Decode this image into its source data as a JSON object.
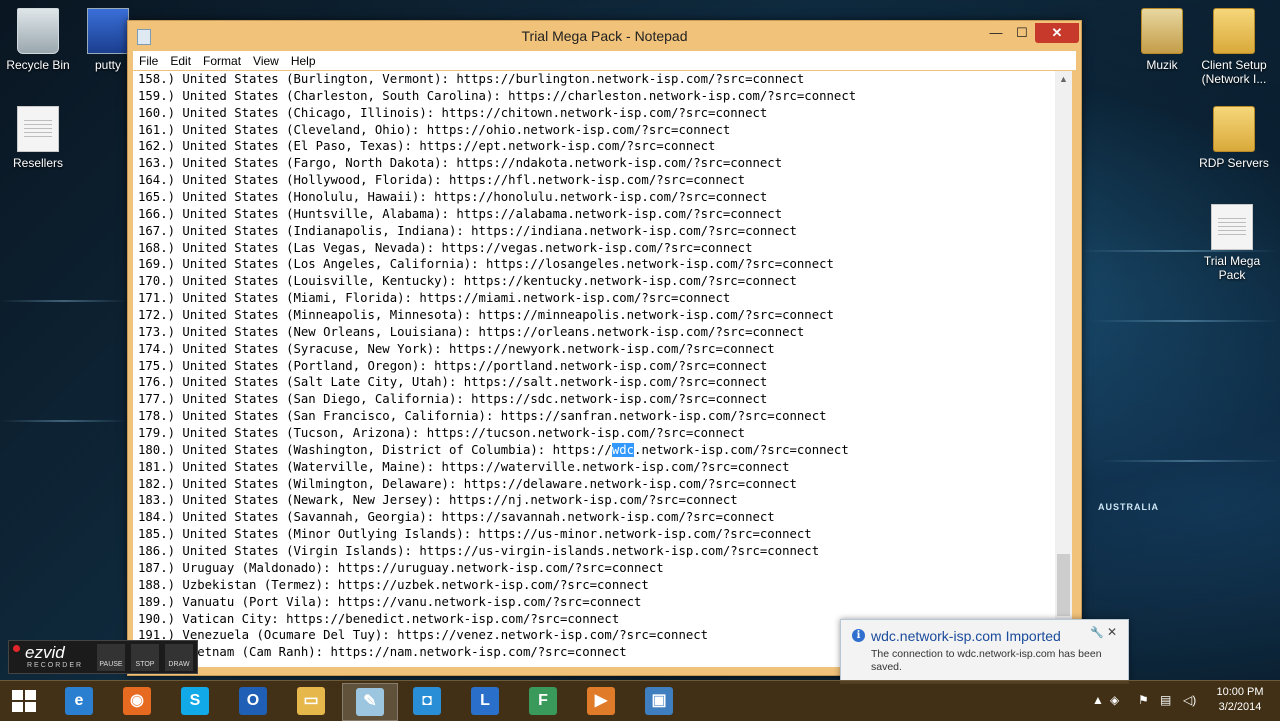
{
  "desktop": {
    "left_icons": [
      {
        "label": "Recycle Bin",
        "icon": "recycle-bin-icon"
      },
      {
        "label": "putty",
        "icon": "putty-icon"
      },
      {
        "label": "Resellers",
        "icon": "text-file-icon"
      }
    ],
    "right_icons": [
      {
        "label": "Muzik",
        "icon": "folder-icon"
      },
      {
        "label": "Client Setup (Network I...",
        "icon": "folder-icon"
      },
      {
        "label": "RDP Servers",
        "icon": "folder-icon"
      },
      {
        "label": "Trial Mega Pack",
        "icon": "text-file-icon"
      }
    ],
    "map_label": "AUSTRALIA"
  },
  "window": {
    "title": "Trial Mega Pack - Notepad",
    "controls": {
      "minimize": "—",
      "maximize": "☐",
      "close": "✕"
    },
    "menu": [
      "File",
      "Edit",
      "Format",
      "View",
      "Help"
    ]
  },
  "editor": {
    "lines": [
      "158.) United States (Burlington, Vermont): https://burlington.network-isp.com/?src=connect",
      "159.) United States (Charleston, South Carolina): https://charleston.network-isp.com/?src=connect",
      "160.) United States (Chicago, Illinois): https://chitown.network-isp.com/?src=connect",
      "161.) United States (Cleveland, Ohio): https://ohio.network-isp.com/?src=connect",
      "162.) United States (El Paso, Texas): https://ept.network-isp.com/?src=connect",
      "163.) United States (Fargo, North Dakota): https://ndakota.network-isp.com/?src=connect",
      "164.) United States (Hollywood, Florida): https://hfl.network-isp.com/?src=connect",
      "165.) United States (Honolulu, Hawaii): https://honolulu.network-isp.com/?src=connect",
      "166.) United States (Huntsville, Alabama): https://alabama.network-isp.com/?src=connect",
      "167.) United States (Indianapolis, Indiana): https://indiana.network-isp.com/?src=connect",
      "168.) United States (Las Vegas, Nevada): https://vegas.network-isp.com/?src=connect",
      "169.) United States (Los Angeles, California): https://losangeles.network-isp.com/?src=connect",
      "170.) United States (Louisville, Kentucky): https://kentucky.network-isp.com/?src=connect",
      "171.) United States (Miami, Florida): https://miami.network-isp.com/?src=connect",
      "172.) United States (Minneapolis, Minnesota): https://minneapolis.network-isp.com/?src=connect",
      "173.) United States (New Orleans, Louisiana): https://orleans.network-isp.com/?src=connect",
      "174.) United States (Syracuse, New York): https://newyork.network-isp.com/?src=connect",
      "175.) United States (Portland, Oregon): https://portland.network-isp.com/?src=connect",
      "176.) United States (Salt Late City, Utah): https://salt.network-isp.com/?src=connect",
      "177.) United States (San Diego, California): https://sdc.network-isp.com/?src=connect",
      "178.) United States (San Francisco, California): https://sanfran.network-isp.com/?src=connect",
      "179.) United States (Tucson, Arizona): https://tucson.network-isp.com/?src=connect",
      "180.) United States (Washington, District of Columbia): https://wdc.network-isp.com/?src=connect",
      "181.) United States (Waterville, Maine): https://waterville.network-isp.com/?src=connect",
      "182.) United States (Wilmington, Delaware): https://delaware.network-isp.com/?src=connect",
      "183.) United States (Newark, New Jersey): https://nj.network-isp.com/?src=connect",
      "184.) United States (Savannah, Georgia): https://savannah.network-isp.com/?src=connect",
      "185.) United States (Minor Outlying Islands): https://us-minor.network-isp.com/?src=connect",
      "186.) United States (Virgin Islands): https://us-virgin-islands.network-isp.com/?src=connect",
      "187.) Uruguay (Maldonado): https://uruguay.network-isp.com/?src=connect",
      "188.) Uzbekistan (Termez): https://uzbek.network-isp.com/?src=connect",
      "189.) Vanuatu (Port Vila): https://vanu.network-isp.com/?src=connect",
      "190.) Vatican City: https://benedict.network-isp.com/?src=connect",
      "191.) Venezuela (Ocumare Del Tuy): https://venez.network-isp.com/?src=connect",
      "192.) Vietnam (Cam Ranh): https://nam.network-isp.com/?src=connect"
    ],
    "selection": {
      "line": "180.) United States (Washington, District of Columbia): https://",
      "selected": "wdc",
      "rest": ".network-isp.com/?src=connect"
    }
  },
  "ezvid": {
    "logo": "ezvid",
    "subtitle": "RECORDER",
    "buttons": [
      "PAUSE",
      "STOP",
      "DRAW"
    ]
  },
  "notification": {
    "title": "wdc.network-isp.com Imported",
    "message": "The connection to wdc.network-isp.com has been saved."
  },
  "taskbar": {
    "apps": [
      {
        "name": "Internet Explorer",
        "icon": "ie-icon",
        "color": "#2b7fd1",
        "glyph": "e"
      },
      {
        "name": "Firefox",
        "icon": "firefox-icon",
        "color": "#e66a1f",
        "glyph": "◉"
      },
      {
        "name": "Skype",
        "icon": "skype-icon",
        "color": "#11a9e8",
        "glyph": "S"
      },
      {
        "name": "Outlook",
        "icon": "outlook-icon",
        "color": "#1f5fb5",
        "glyph": "O"
      },
      {
        "name": "File Explorer",
        "icon": "folder-icon",
        "color": "#e6b84c",
        "glyph": "▭"
      },
      {
        "name": "Notepad",
        "icon": "notepad-icon",
        "color": "#9cc6e0",
        "glyph": "✎"
      },
      {
        "name": "Folder App",
        "icon": "folder-app-icon",
        "color": "#2a8ed6",
        "glyph": "◘"
      },
      {
        "name": "Lync",
        "icon": "lync-icon",
        "color": "#2a6fc9",
        "glyph": "L"
      },
      {
        "name": "FTP",
        "icon": "ftp-icon",
        "color": "#3a9a5b",
        "glyph": "F"
      },
      {
        "name": "Media Player",
        "icon": "media-icon",
        "color": "#e07b2a",
        "glyph": "▶"
      },
      {
        "name": "Remote Desktop",
        "icon": "remote-desktop-icon",
        "color": "#3f7fc0",
        "glyph": "▣"
      }
    ],
    "clock": {
      "time": "10:00 PM",
      "date": "3/2/2014"
    }
  }
}
